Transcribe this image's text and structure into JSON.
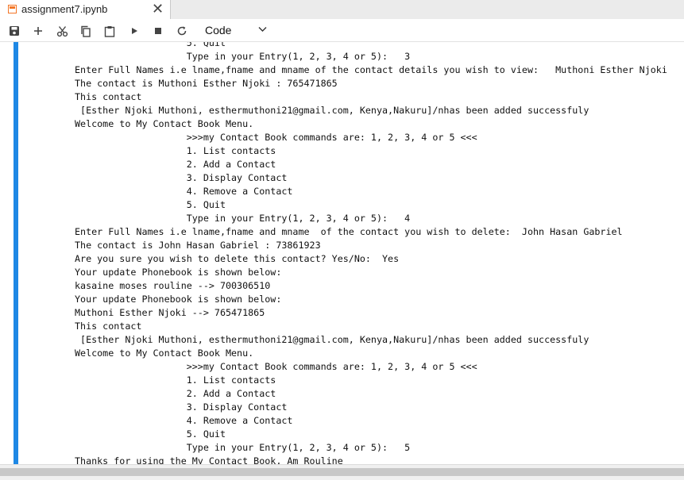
{
  "tab": {
    "title": "assignment7.ipynb",
    "icon": "notebook-icon",
    "close_icon": "close-icon"
  },
  "toolbar": {
    "buttons": [
      "save-icon",
      "plus-icon",
      "cut-icon",
      "copy-icon",
      "paste-icon",
      "run-icon",
      "stop-icon",
      "restart-icon"
    ],
    "cell_type": "Code",
    "accent": "#1e88e5"
  },
  "output": {
    "lines": [
      "                    5. Quit",
      "                    Type in your Entry(1, 2, 3, 4 or 5):   3",
      "Enter Full Names i.e lname,fname and mname of the contact details you wish to view:   Muthoni Esther Njoki",
      "The contact is Muthoni Esther Njoki : 765471865",
      "This contact",
      " [Esther Njoki Muthoni, esthermuthoni21@gmail.com, Kenya,Nakuru]/nhas been added successfuly",
      "Welcome to My Contact Book Menu.",
      "                    >>>my Contact Book commands are: 1, 2, 3, 4 or 5 <<<",
      "                    1. List contacts",
      "                    2. Add a Contact",
      "                    3. Display Contact",
      "                    4. Remove a Contact",
      "                    5. Quit",
      "                    Type in your Entry(1, 2, 3, 4 or 5):   4",
      "Enter Full Names i.e lname,fname and mname  of the contact you wish to delete:  John Hasan Gabriel",
      "The contact is John Hasan Gabriel : 73861923",
      "Are you sure you wish to delete this contact? Yes/No:  Yes",
      "Your update Phonebook is shown below:",
      "kasaine moses rouline --> 700306510",
      "Your update Phonebook is shown below:",
      "Muthoni Esther Njoki --> 765471865",
      "This contact",
      " [Esther Njoki Muthoni, esthermuthoni21@gmail.com, Kenya,Nakuru]/nhas been added successfuly",
      "Welcome to My Contact Book Menu.",
      "                    >>>my Contact Book commands are: 1, 2, 3, 4 or 5 <<<",
      "                    1. List contacts",
      "                    2. Add a Contact",
      "                    3. Display Contact",
      "                    4. Remove a Contact",
      "                    5. Quit",
      "                    Type in your Entry(1, 2, 3, 4 or 5):   5",
      "Thanks for using the My Contact Book, Am Rouline"
    ]
  }
}
